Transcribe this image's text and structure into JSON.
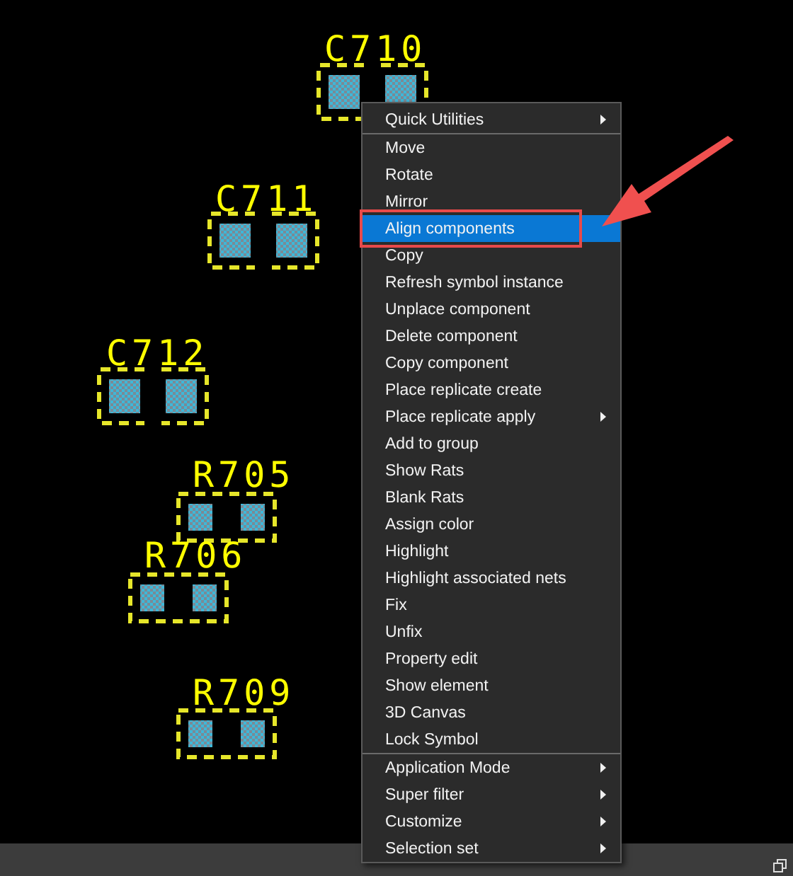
{
  "canvas": {
    "components": [
      {
        "label": "C710",
        "kind": "capacitor"
      },
      {
        "label": "C711",
        "kind": "capacitor"
      },
      {
        "label": "C712",
        "kind": "capacitor"
      },
      {
        "label": "R705",
        "kind": "resistor"
      },
      {
        "label": "R706",
        "kind": "resistor"
      },
      {
        "label": "R709",
        "kind": "resistor"
      }
    ]
  },
  "context_menu": {
    "sections": [
      [
        {
          "label": "Quick Utilities",
          "submenu": true,
          "selected": false
        }
      ],
      [
        {
          "label": "Move",
          "submenu": false,
          "selected": false
        },
        {
          "label": "Rotate",
          "submenu": false,
          "selected": false
        },
        {
          "label": "Mirror",
          "submenu": false,
          "selected": false
        },
        {
          "label": "Align components",
          "submenu": false,
          "selected": true
        },
        {
          "label": "Copy",
          "submenu": false,
          "selected": false
        },
        {
          "label": "Refresh symbol instance",
          "submenu": false,
          "selected": false
        },
        {
          "label": "Unplace component",
          "submenu": false,
          "selected": false
        },
        {
          "label": "Delete component",
          "submenu": false,
          "selected": false
        },
        {
          "label": "Copy component",
          "submenu": false,
          "selected": false
        },
        {
          "label": "Place replicate create",
          "submenu": false,
          "selected": false
        },
        {
          "label": "Place replicate apply",
          "submenu": true,
          "selected": false
        },
        {
          "label": "Add to group",
          "submenu": false,
          "selected": false
        },
        {
          "label": "Show Rats",
          "submenu": false,
          "selected": false
        },
        {
          "label": "Blank Rats",
          "submenu": false,
          "selected": false
        },
        {
          "label": "Assign color",
          "submenu": false,
          "selected": false
        },
        {
          "label": "Highlight",
          "submenu": false,
          "selected": false
        },
        {
          "label": "Highlight associated nets",
          "submenu": false,
          "selected": false
        },
        {
          "label": "Fix",
          "submenu": false,
          "selected": false
        },
        {
          "label": "Unfix",
          "submenu": false,
          "selected": false
        },
        {
          "label": "Property edit",
          "submenu": false,
          "selected": false
        },
        {
          "label": "Show element",
          "submenu": false,
          "selected": false
        },
        {
          "label": "3D Canvas",
          "submenu": false,
          "selected": false
        },
        {
          "label": "Lock Symbol",
          "submenu": false,
          "selected": false
        }
      ],
      [
        {
          "label": "Application Mode",
          "submenu": true,
          "selected": false
        },
        {
          "label": "Super filter",
          "submenu": true,
          "selected": false
        },
        {
          "label": "Customize",
          "submenu": true,
          "selected": false
        },
        {
          "label": "Selection set",
          "submenu": true,
          "selected": false
        }
      ]
    ]
  }
}
